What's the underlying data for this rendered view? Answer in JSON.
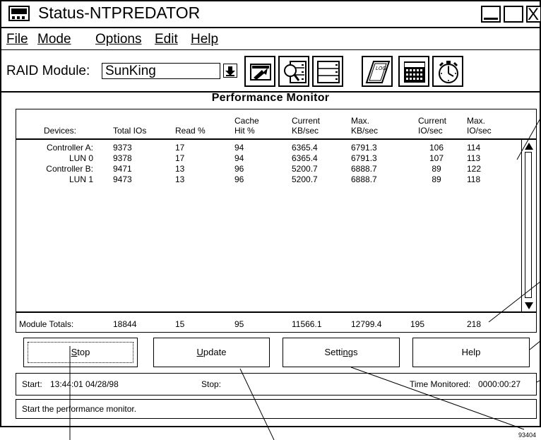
{
  "window": {
    "title": "Status-NTPREDATOR"
  },
  "menu": [
    {
      "label": "File"
    },
    {
      "label": "Mode"
    },
    {
      "label": "Options"
    },
    {
      "label": "Edit"
    },
    {
      "label": "Help"
    }
  ],
  "toolbar": {
    "raid_label": "RAID Module:",
    "raid_value": "SunKing",
    "tools": [
      "configuration-icon",
      "status-icon",
      "recovery-icon",
      "log-icon",
      "maintenance-icon",
      "timer-icon"
    ],
    "log_icon_text": "LOG"
  },
  "monitor": {
    "title": "Performance Monitor",
    "columns": [
      {
        "l1": "",
        "l2": "Devices:"
      },
      {
        "l1": "",
        "l2": "Total IOs"
      },
      {
        "l1": "",
        "l2": "Read %"
      },
      {
        "l1": "Cache",
        "l2": "Hit %"
      },
      {
        "l1": "Current",
        "l2": "KB/sec"
      },
      {
        "l1": "Max.",
        "l2": "KB/sec"
      },
      {
        "l1": "Current",
        "l2": "IO/sec"
      },
      {
        "l1": "Max.",
        "l2": "IO/sec"
      }
    ],
    "rows": [
      [
        "Controller A:",
        "9373",
        "17",
        "94",
        "6365.4",
        "6791.3",
        "106",
        "114"
      ],
      [
        "LUN 0",
        "9378",
        "17",
        "94",
        "6365.4",
        "6791.3",
        "107",
        "113"
      ],
      [
        "Controller B:",
        "9471",
        "13",
        "96",
        "5200.7",
        "6888.7",
        "89",
        "122"
      ],
      [
        "LUN 1",
        "9473",
        "13",
        "96",
        "5200.7",
        "6888.7",
        "89",
        "118"
      ]
    ],
    "totals": [
      "Module Totals:",
      "18844",
      "15",
      "95",
      "11566.1",
      "12799.4",
      "195",
      "218"
    ]
  },
  "buttons": {
    "stop": {
      "pre": "",
      "u": "S",
      "post": "top"
    },
    "update": {
      "pre": "",
      "u": "U",
      "post": "pdate"
    },
    "settings": {
      "pre": "Setti",
      "u": "n",
      "post": "gs"
    },
    "help": {
      "pre": "Help",
      "u": "",
      "post": ""
    }
  },
  "status": {
    "start_label": "Start:",
    "start_value": "13:44:01  04/28/98",
    "stop_label": "Stop:",
    "time_label": "Time Monitored:",
    "time_value": "0000:00:27",
    "message": "Start the performance monitor."
  },
  "figure_number": "93404"
}
